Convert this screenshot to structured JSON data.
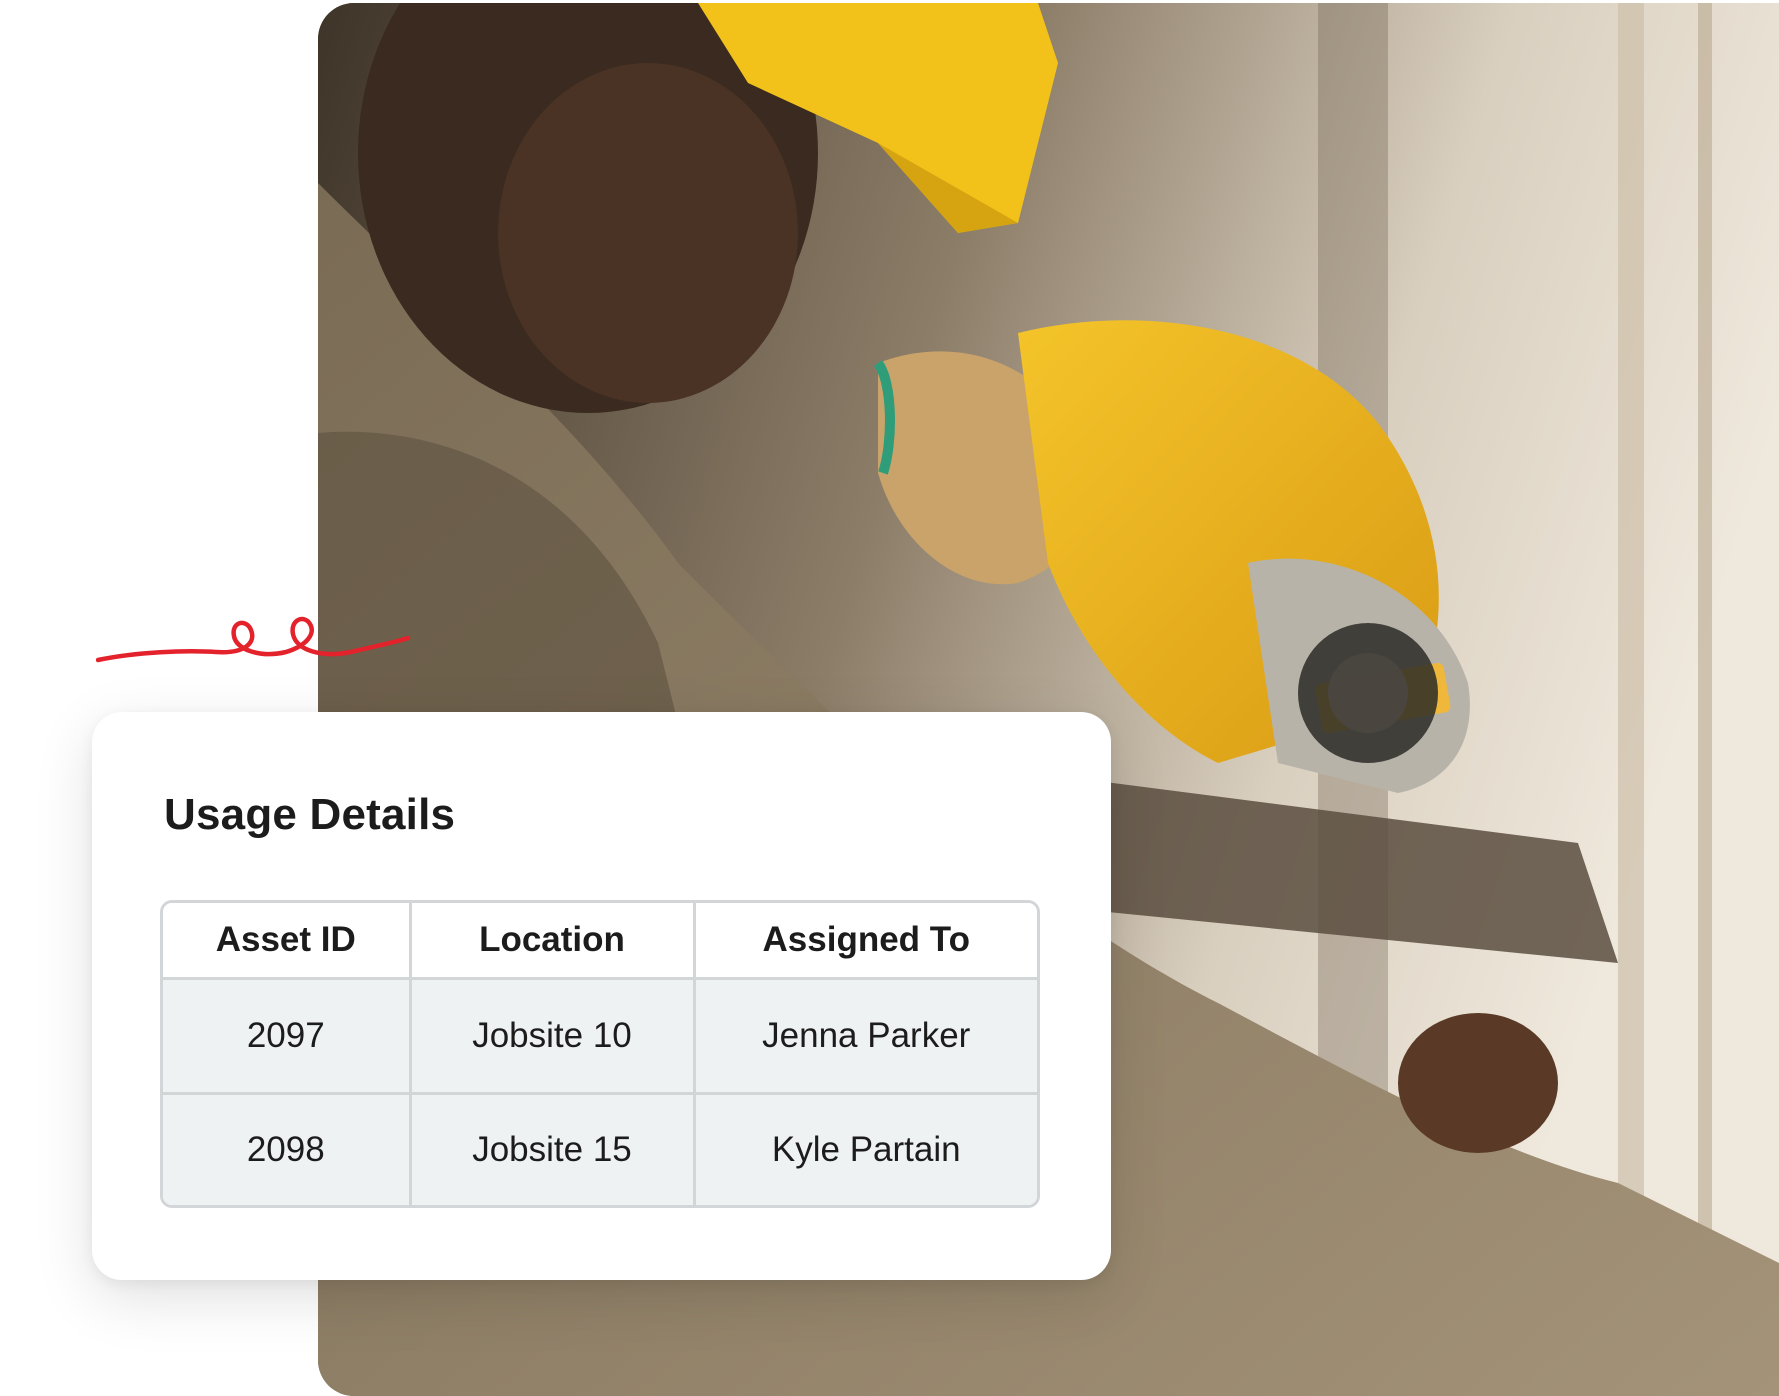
{
  "card": {
    "title": "Usage Details"
  },
  "table": {
    "headers": [
      "Asset ID",
      "Location",
      "Assigned To"
    ],
    "rows": [
      [
        "2097",
        "Jobsite 10",
        "Jenna Parker"
      ],
      [
        "2098",
        "Jobsite 15",
        "Kyle Partain"
      ]
    ]
  },
  "colors": {
    "accent_squiggle": "#e3222b",
    "table_row_bg": "#eef2f2",
    "table_border": "#d3d6d8",
    "hardhat_yellow": "#f2c21b"
  },
  "images": {
    "photo_icon": "worker-with-hardhat-and-saw-photo"
  }
}
